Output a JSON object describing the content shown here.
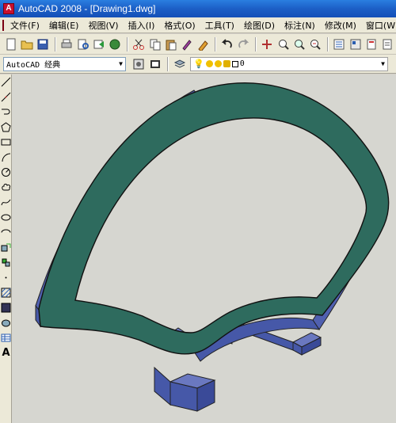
{
  "window": {
    "title": "AutoCAD 2008 - [Drawing1.dwg]"
  },
  "menu": {
    "items": [
      "文件(F)",
      "编辑(E)",
      "视图(V)",
      "插入(I)",
      "格式(O)",
      "工具(T)",
      "绘图(D)",
      "标注(N)",
      "修改(M)",
      "窗口(W)"
    ]
  },
  "toolbar2": {
    "workspace": "AutoCAD 经典",
    "layer_value": "0"
  },
  "draw_toolbar": {
    "text_tool_label": "A"
  },
  "colors": {
    "solid_top": "#2e6b5e",
    "solid_side": "#5060b0",
    "viewport_bg": "#d6d6d0"
  }
}
